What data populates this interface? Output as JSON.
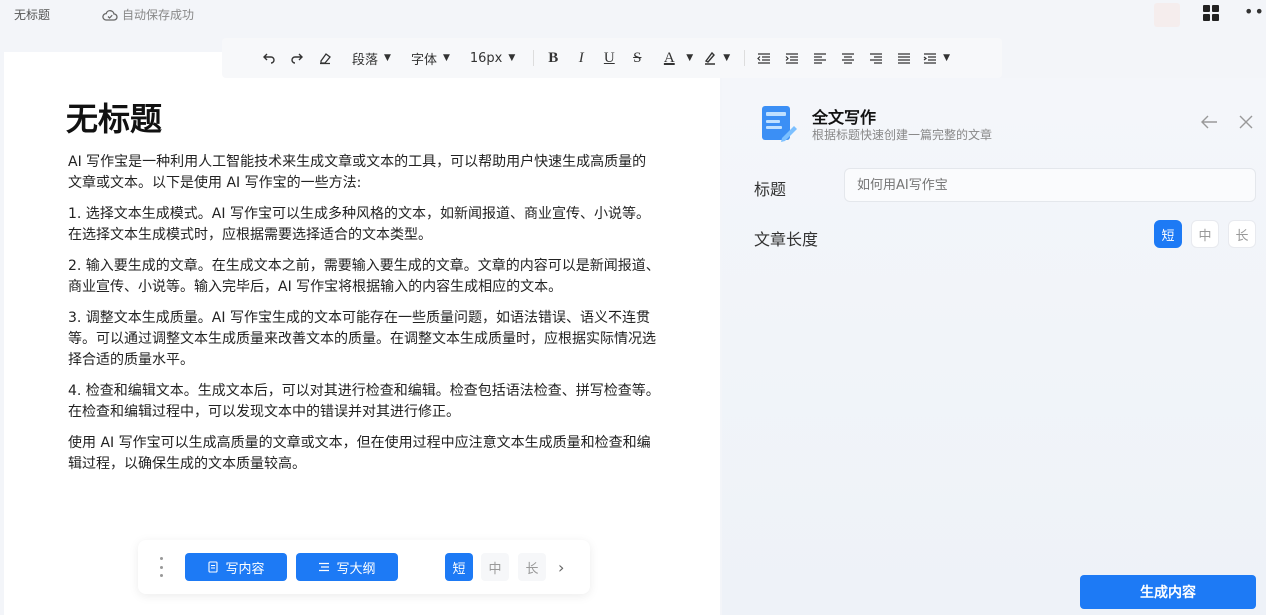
{
  "topbar": {
    "doc_name": "无标题",
    "save_status": "自动保存成功"
  },
  "toolbar": {
    "paragraph_label": "段落",
    "font_label": "字体",
    "size_label": "16px",
    "bold": "B",
    "italic": "I",
    "underline": "U",
    "strike": "S",
    "font_color": "A"
  },
  "document": {
    "title": "无标题",
    "paragraphs": [
      "AI 写作宝是一种利用人工智能技术来生成文章或文本的工具，可以帮助用户快速生成高质量的文章或文本。以下是使用 AI 写作宝的一些方法:",
      "1. 选择文本生成模式。AI 写作宝可以生成多种风格的文本，如新闻报道、商业宣传、小说等。在选择文本生成模式时，应根据需要选择适合的文本类型。",
      "2. 输入要生成的文章。在生成文本之前，需要输入要生成的文章。文章的内容可以是新闻报道、商业宣传、小说等。输入完毕后，AI 写作宝将根据输入的内容生成相应的文本。",
      "3. 调整文本生成质量。AI 写作宝生成的文本可能存在一些质量问题，如语法错误、语义不连贯等。可以通过调整文本生成质量来改善文本的质量。在调整文本生成质量时，应根据实际情况选择合适的质量水平。",
      "4. 检查和编辑文本。生成文本后，可以对其进行检查和编辑。检查包括语法检查、拼写检查等。在检查和编辑过程中，可以发现文本中的错误并对其进行修正。",
      "使用 AI 写作宝可以生成高质量的文章或文本，但在使用过程中应注意文本生成质量和检查和编辑过程，以确保生成的文本质量较高。"
    ]
  },
  "float_bar": {
    "write_content": "写内容",
    "write_outline": "写大纲",
    "short": "短",
    "medium": "中",
    "long": "长"
  },
  "side_panel": {
    "title": "全文写作",
    "subtitle": "根据标题快速创建一篇完整的文章",
    "title_label": "标题",
    "title_placeholder": "如何用AI写作宝",
    "length_label": "文章长度",
    "short": "短",
    "medium": "中",
    "long": "长",
    "generate_button": "生成内容"
  },
  "colors": {
    "accent": "#1d7af5",
    "panel_bg": "#f4f6fa"
  }
}
